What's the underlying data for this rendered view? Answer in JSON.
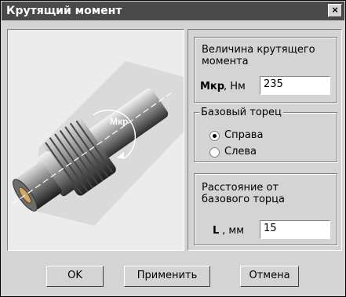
{
  "window": {
    "title": "Крутящий момент",
    "close_label": "×"
  },
  "image": {
    "label": "Мкр"
  },
  "torque": {
    "caption_line1": "Величина крутящего",
    "caption_line2": "момента",
    "field_label_bold": "Мкр",
    "field_label_unit": ", Нм",
    "value": "235"
  },
  "base_face": {
    "legend": "Базовый торец",
    "options": [
      {
        "label": "Справа",
        "selected": true
      },
      {
        "label": "Слева",
        "selected": false
      }
    ]
  },
  "distance": {
    "caption_line1": "Расстояние от",
    "caption_line2": "базового торца",
    "field_label_bold": "L",
    "field_label_unit": " , мм",
    "value": "15"
  },
  "buttons": {
    "ok": "OK",
    "apply": "Применить",
    "cancel": "Отмена"
  }
}
